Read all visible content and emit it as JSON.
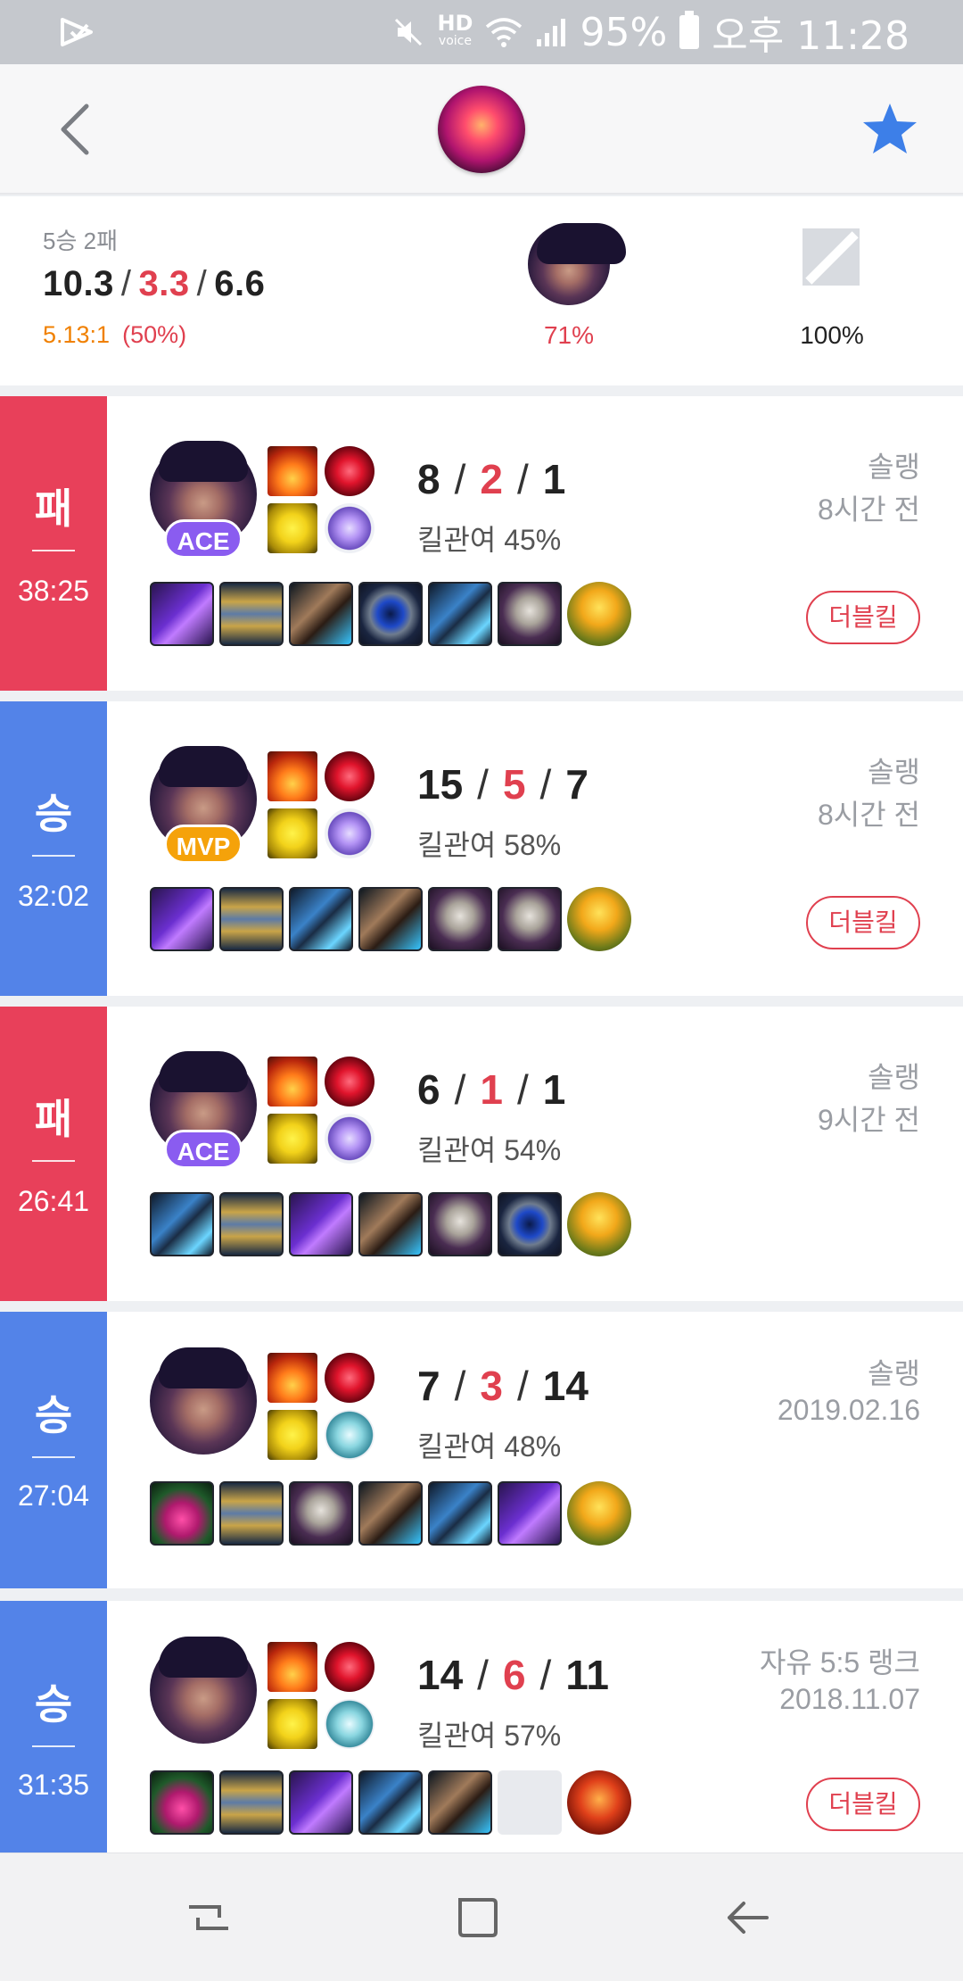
{
  "status_bar": {
    "hd_label": "HD",
    "hd_sub": "voice",
    "battery": "95%",
    "time": "오후 11:28"
  },
  "summary": {
    "record": "5승 2패",
    "kills": "10.3",
    "deaths": "3.3",
    "assists": "6.6",
    "kda_ratio": "5.13:1",
    "kill_participation": "(50%)",
    "champion_winrate": "71%",
    "position_rate": "100%"
  },
  "matches": [
    {
      "result": "패",
      "duration": "38:25",
      "badge": "ACE",
      "kills": "8",
      "deaths": "2",
      "assists": "1",
      "kill_participation": "킬관여 45%",
      "queue": "솔랭",
      "time_ago": "8시간 전",
      "multikill": "더블킬",
      "items": [
        "purple-orb",
        "hourglass",
        "sorcerer-boots",
        "blue-ring",
        "void-blade",
        "skull-staff",
        "yellow-trinket"
      ]
    },
    {
      "result": "승",
      "duration": "32:02",
      "badge": "MVP",
      "kills": "15",
      "deaths": "5",
      "assists": "7",
      "kill_participation": "킬관여 58%",
      "queue": "솔랭",
      "time_ago": "8시간 전",
      "multikill": "더블킬",
      "items": [
        "purple-orb",
        "hourglass",
        "void-blade",
        "sorcerer-boots",
        "skull-staff",
        "skull-staff",
        "yellow-trinket"
      ]
    },
    {
      "result": "패",
      "duration": "26:41",
      "badge": "ACE",
      "kills": "6",
      "deaths": "1",
      "assists": "1",
      "kill_participation": "킬관여 54%",
      "queue": "솔랭",
      "time_ago": "9시간 전",
      "items": [
        "void-blade",
        "hourglass",
        "purple-orb",
        "sorcerer-boots",
        "skull-staff",
        "blue-ring",
        "yellow-trinket"
      ]
    },
    {
      "result": "승",
      "duration": "27:04",
      "kills": "7",
      "deaths": "3",
      "assists": "14",
      "kill_participation": "킬관여 48%",
      "queue": "솔랭",
      "time_ago": "2019.02.16",
      "items": [
        "dark-potion",
        "hourglass",
        "skull-staff",
        "sorcerer-boots",
        "void-blade",
        "purple-orb",
        "yellow-trinket"
      ]
    },
    {
      "result": "승",
      "duration": "31:35",
      "kills": "14",
      "deaths": "6",
      "assists": "11",
      "kill_participation": "킬관여 57%",
      "queue": "자유 5:5 랭크",
      "time_ago": "2018.11.07",
      "multikill": "더블킬",
      "items": [
        "dark-potion",
        "hourglass",
        "purple-orb",
        "void-blade",
        "sorcerer-boots",
        "empty-slot",
        "red-trinket"
      ]
    }
  ],
  "colors": {
    "loss": "#e8405a",
    "win": "#5383e8",
    "death_red": "#e0404f",
    "ratio_orange": "#f08000",
    "star_blue": "#3d7fe8"
  }
}
